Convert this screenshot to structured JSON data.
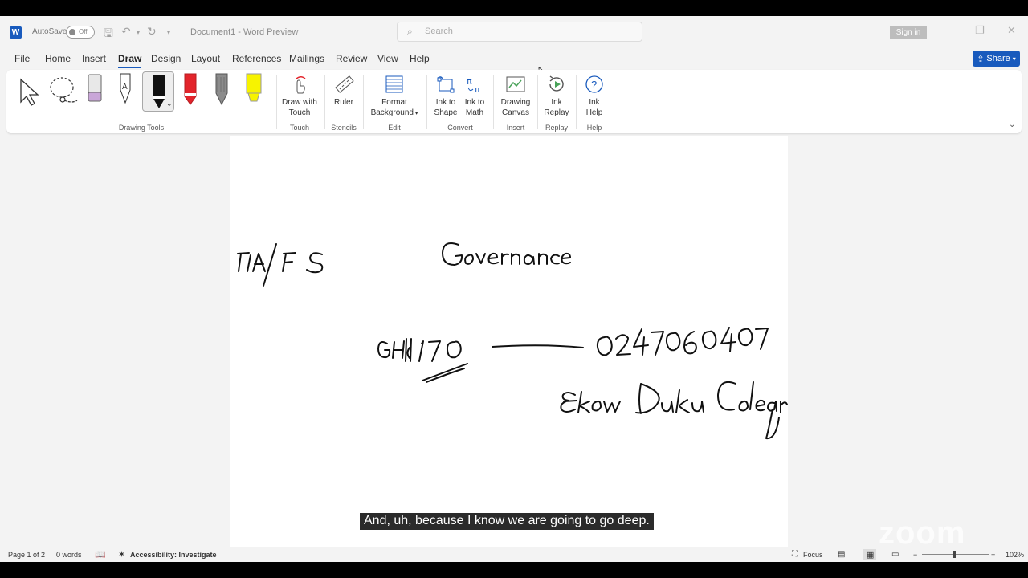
{
  "titlebar": {
    "autosave_label": "AutoSave",
    "autosave_state": "Off",
    "document_title": "Document1 - Word Preview",
    "search_placeholder": "Search",
    "signin_label": "Sign in"
  },
  "tabs": [
    "File",
    "Home",
    "Insert",
    "Draw",
    "Design",
    "Layout",
    "References",
    "Mailings",
    "Review",
    "View",
    "Help"
  ],
  "active_tab": "Draw",
  "share_label": "Share",
  "ribbon": {
    "groups": {
      "drawing_tools": "Drawing Tools",
      "touch": "Touch",
      "stencils": "Stencils",
      "edit": "Edit",
      "convert": "Convert",
      "insert": "Insert",
      "replay": "Replay",
      "help": "Help"
    },
    "buttons": {
      "draw_with_touch": [
        "Draw with",
        "Touch"
      ],
      "ruler": "Ruler",
      "format_background": [
        "Format",
        "Background"
      ],
      "ink_to_shape": [
        "Ink to",
        "Shape"
      ],
      "ink_to_math": [
        "Ink to",
        "Math"
      ],
      "drawing_canvas": [
        "Drawing",
        "Canvas"
      ],
      "ink_replay": [
        "Ink",
        "Replay"
      ],
      "ink_help": [
        "Ink",
        "Help"
      ]
    },
    "pen_colors": {
      "black": "#111111",
      "red": "#e3242b",
      "gray": "#8c8c8c",
      "yellow": "#f7f300",
      "eraser": "#c9a6d8"
    }
  },
  "handwriting": {
    "line1_left": "FIA/FS",
    "line1_right": "Governance",
    "line2_left": "GH₵170",
    "line2_right": "0247060407",
    "line3": "Ekow Duku Coleangle"
  },
  "caption": "And, uh, because I know we are going to go deep.",
  "watermark": "zoom",
  "status": {
    "page": "Page 1 of 2",
    "words": "0 words",
    "accessibility": "Accessibility: Investigate",
    "focus": "Focus",
    "zoom": "102%"
  },
  "colors": {
    "accent": "#185abd",
    "caption_bg": "#2b2b2b"
  }
}
